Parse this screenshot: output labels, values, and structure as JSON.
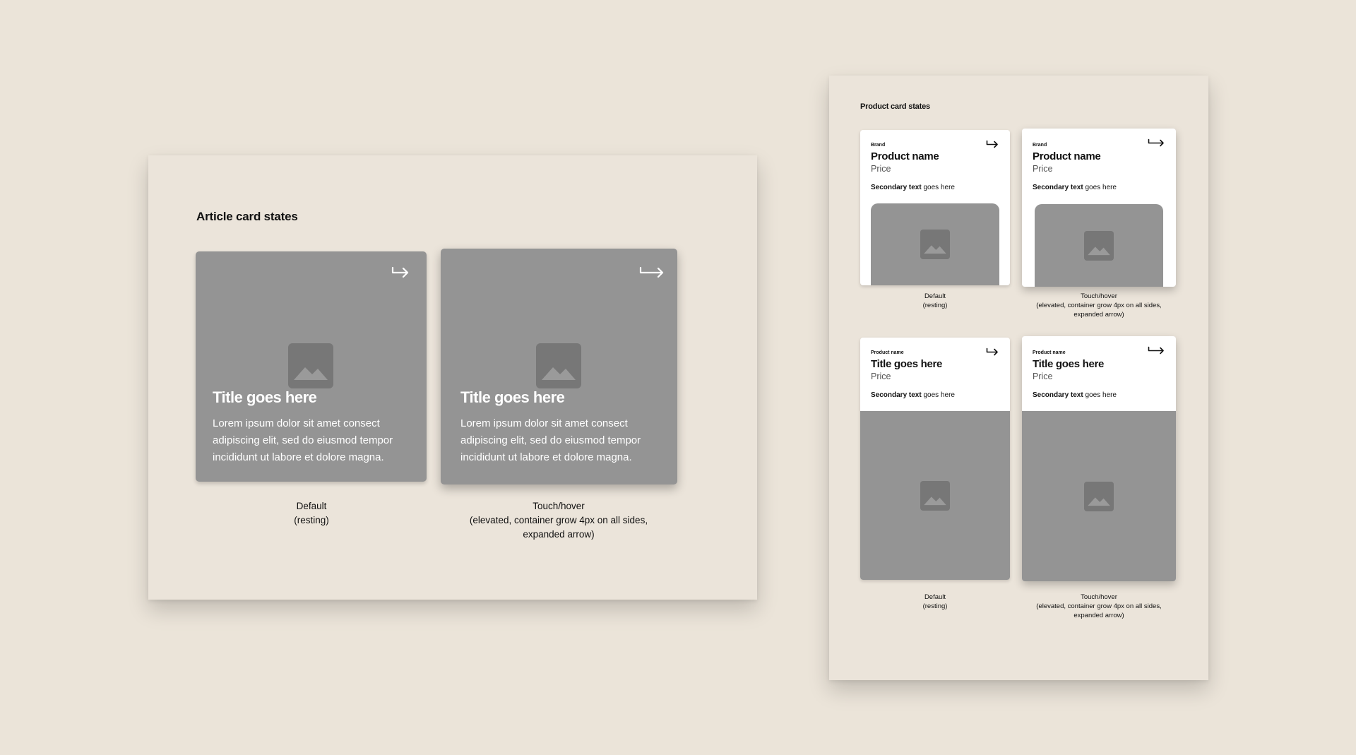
{
  "article_board": {
    "title": "Article card states",
    "cards": [
      {
        "title": "Title goes here",
        "body": "Lorem ipsum dolor sit amet consect adipiscing elit, sed do eiusmod tempor incididunt ut labore et dolore magna.",
        "caption_lines": [
          "Default",
          "(resting)"
        ]
      },
      {
        "title": "Title goes here",
        "body": "Lorem ipsum dolor sit amet consect adipiscing elit, sed do eiusmod tempor incididunt ut labore et dolore magna.",
        "caption_lines": [
          "Touch/hover",
          "(elevated, container grow 4px on all sides,",
          "expanded arrow)"
        ]
      }
    ]
  },
  "product_board": {
    "title": "Product card states",
    "rows": [
      {
        "cards": [
          {
            "eyebrow": "Brand",
            "name": "Product name",
            "price": "Price",
            "secondary_bold": "Secondary text",
            "secondary_rest": " goes here"
          },
          {
            "eyebrow": "Brand",
            "name": "Product name",
            "price": "Price",
            "secondary_bold": "Secondary text",
            "secondary_rest": " goes here"
          }
        ],
        "captions": [
          [
            "Default",
            "(resting)"
          ],
          [
            "Touch/hover",
            "(elevated, container grow 4px on all sides,",
            "expanded arrow)"
          ]
        ]
      },
      {
        "cards": [
          {
            "eyebrow": "Product name",
            "name": "Title goes here",
            "price": "Price",
            "secondary_bold": "Secondary text",
            "secondary_rest": " goes here"
          },
          {
            "eyebrow": "Product name",
            "name": "Title goes here",
            "price": "Price",
            "secondary_bold": "Secondary text",
            "secondary_rest": " goes here"
          }
        ],
        "captions": [
          [
            "Default",
            "(resting)"
          ],
          [
            "Touch/hover",
            "(elevated, container grow 4px on all sides,",
            "expanded arrow)"
          ]
        ]
      }
    ]
  },
  "icons": {
    "image_placeholder": "image-icon",
    "arrow": "arrow-right-hook-icon"
  },
  "colors": {
    "background": "#ebe4d9",
    "placeholder": "#949494",
    "placeholder_icon": "#777777",
    "card_white": "#ffffff"
  }
}
